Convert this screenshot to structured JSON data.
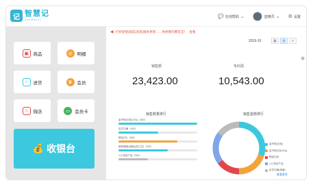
{
  "app": {
    "name": "智慧记",
    "sub": "ZHIHUIJI",
    "mark": "记"
  },
  "header": {
    "help_label": "在线帮助",
    "user_name": "蓝精灵",
    "settings_label": "设置",
    "help_icon": "chat-bubble-icon",
    "settings_icon": "gear-icon"
  },
  "sidebar": {
    "tiles": [
      {
        "label": "商品",
        "icon": "商品-icon",
        "color": "#e0474c",
        "glyph": "▣"
      },
      {
        "label": "明细",
        "icon": "coin-icon",
        "color": "#f2a33a",
        "glyph": "◎"
      },
      {
        "label": "进货",
        "icon": "cart-icon",
        "color": "#3cc8de",
        "glyph": "⌂"
      },
      {
        "label": "会员",
        "icon": "crown-icon",
        "color": "#f2a33a",
        "glyph": "♛"
      },
      {
        "label": "微店",
        "icon": "store-icon",
        "color": "#e0474c",
        "glyph": "⌂"
      },
      {
        "label": "会员卡",
        "icon": "card-icon",
        "color": "#46b35f",
        "glyph": "▭"
      }
    ],
    "cashier_label": "收银台"
  },
  "main": {
    "notice": "打折促销|提成|充值|版本更新……你想要的都在这！",
    "notice_link": "查看",
    "date": "2019-10",
    "views": [
      "▦",
      "▥",
      "≡"
    ],
    "stats": [
      {
        "label": "销售额",
        "value": "23,423.00"
      },
      {
        "label": "毛利润",
        "value": "10,543.00"
      }
    ],
    "sales_title": "销售数量排行",
    "pie_title": "销售金额排行",
    "more_link": "查看更多"
  },
  "chart_data": [
    {
      "type": "bar",
      "title": "销售数量排行",
      "categories": [
        "金不换(白色)100g（800）",
        "百岁白鹿（400）",
        "精品(白)（600）",
        "新鲜蒲菜(纯度)(西兰瓜)（500）",
        "1-5 测试产品（300）"
      ],
      "values": [
        800,
        400,
        600,
        500,
        300
      ],
      "colors": [
        "#3cc8de",
        "#3cc8de",
        "#f2a33a",
        "#3cc8de",
        "#bbbbbb"
      ]
    },
    {
      "type": "pie",
      "title": "销售金额排行",
      "categories": [
        "金不换(白色)",
        "金不换白色100g",
        "精品白色",
        "1-5 测试产品",
        "百岁白鹿(纯度)"
      ],
      "values": [
        30,
        20,
        15,
        20,
        15
      ],
      "colors": [
        "#3cc8de",
        "#f2a33a",
        "#e0474c",
        "#7ea7e8",
        "#bbbbbb"
      ]
    }
  ]
}
